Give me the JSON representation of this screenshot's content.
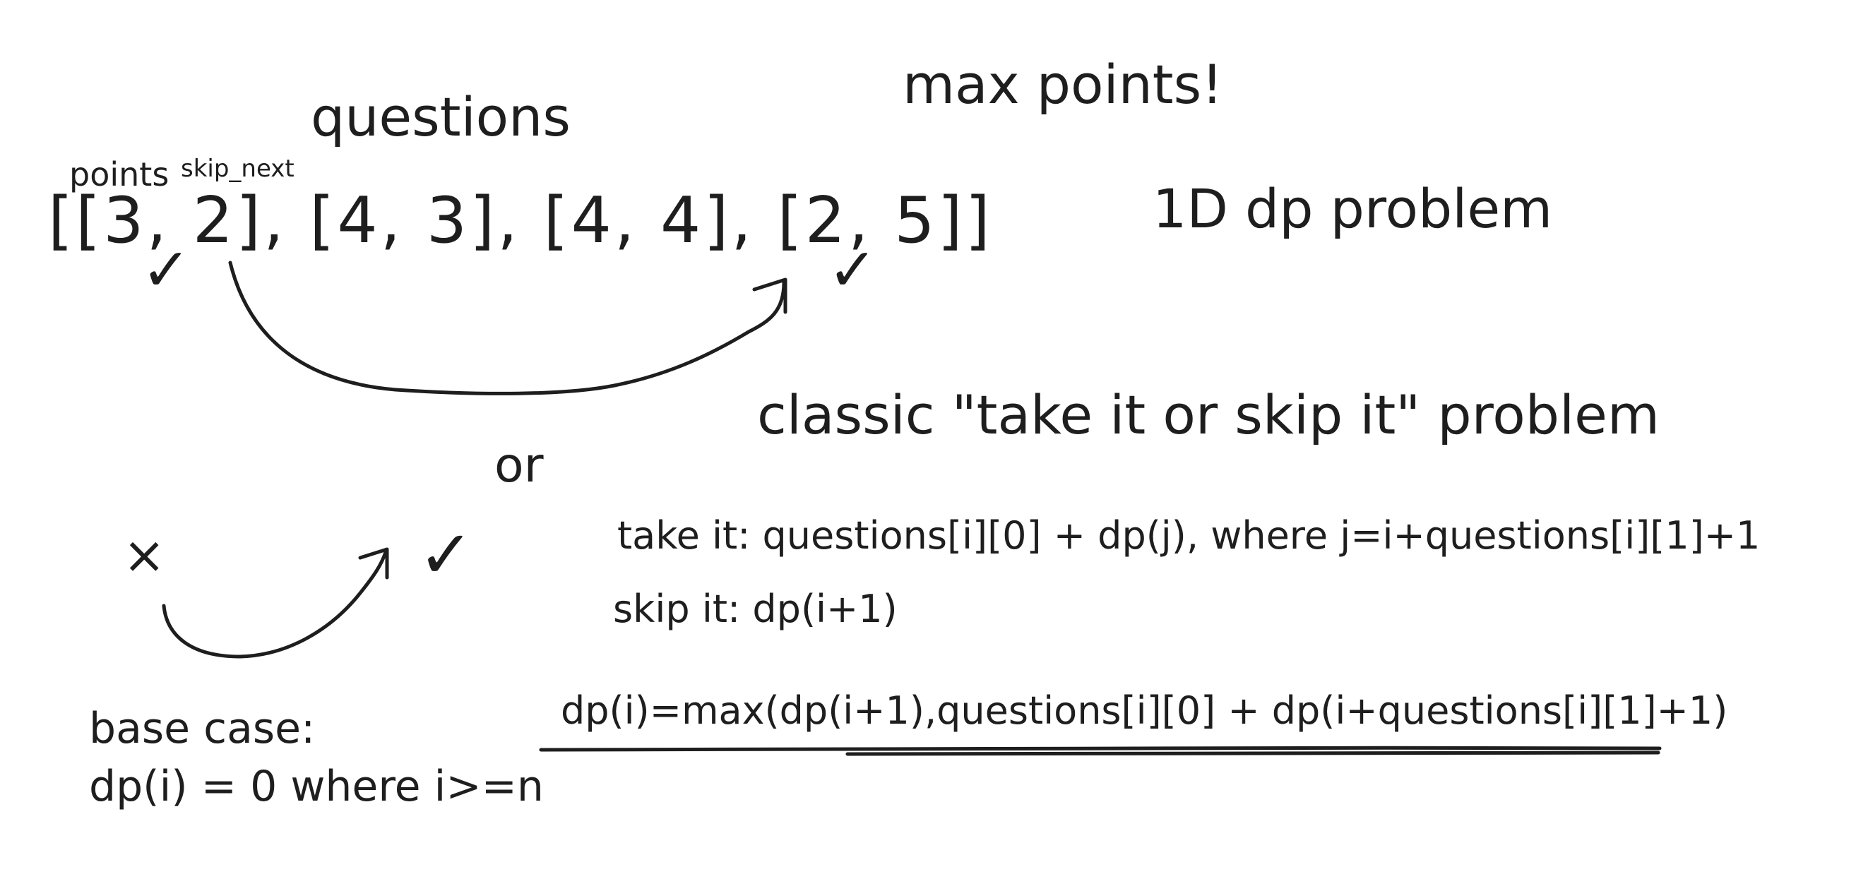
{
  "title": "max points!",
  "heading": "questions",
  "labels": {
    "points": "points",
    "skip_next": "skip_next"
  },
  "array_text": "[[3, 2], [4, 3], [4, 4], [2, 5]]",
  "problem_type": "1D dp problem",
  "classic": "classic \"take it or skip it\" problem",
  "or": "or",
  "marks": {
    "cross": "×",
    "check": "✓"
  },
  "take_it": "take it: questions[i][0] + dp(j), where j=i+questions[i][1]+1",
  "skip_it": "skip it: dp(i+1)",
  "recurrence": "dp(i)=max(dp(i+1),questions[i][0] + dp(i+questions[i][1]+1)",
  "base_case": {
    "label": "base case:",
    "rule": "dp(i) = 0 where i>=n"
  },
  "ink_color": "#1e1e1e",
  "background_color": "#ffffff"
}
